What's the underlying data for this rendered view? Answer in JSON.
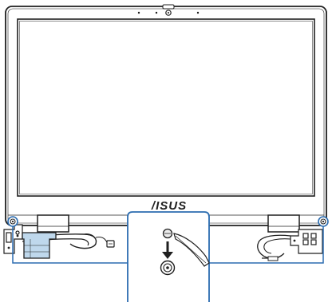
{
  "figure": {
    "brand_logo": "/ISUS"
  },
  "colors": {
    "outline": "#1f1f1f",
    "callout": "#2b6cb0",
    "cable_fill": "#bfd8ec",
    "screen_border": "#3a3a3a"
  },
  "icons": {
    "arrow": "arrow-down-icon",
    "screw": "screw-icon",
    "screwdriver": "screwdriver-icon",
    "camera": "camera-icon"
  }
}
